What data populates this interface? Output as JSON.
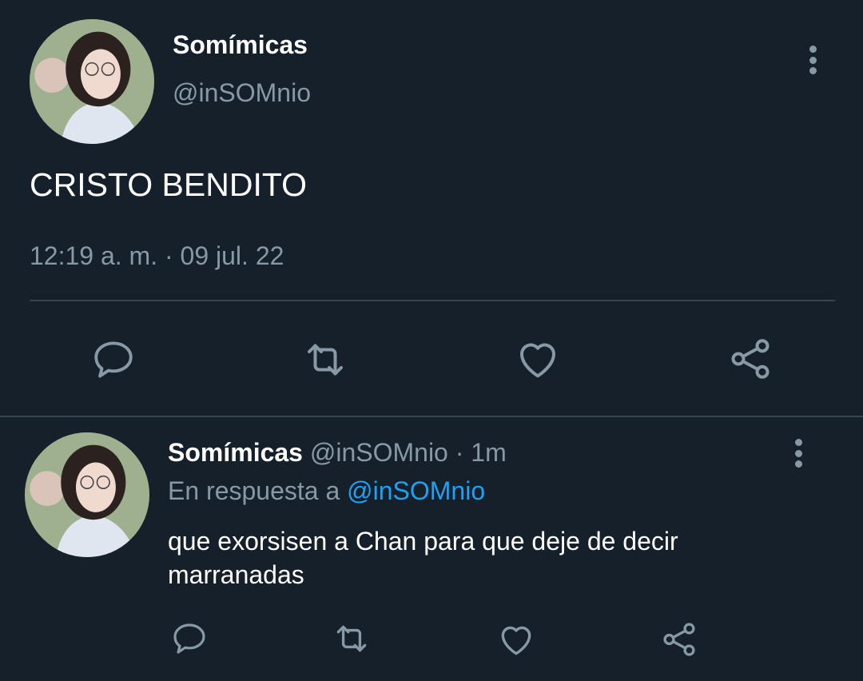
{
  "main_tweet": {
    "display_name": "Somímicas",
    "handle": "@inSOMnio",
    "text": "CRISTO BENDITO",
    "timestamp": "12:19 a. m. · 09 jul. 22"
  },
  "reply_tweet": {
    "display_name": "Somímicas",
    "handle": "@inSOMnio",
    "separator": "·",
    "time_ago": "1m",
    "reply_prefix": "En respuesta a",
    "reply_to": "@inSOMnio",
    "text": "que exorsisen a Chan para que deje de decir marranadas"
  },
  "icons": {
    "reply": "reply-icon",
    "retweet": "retweet-icon",
    "like": "heart-icon",
    "share": "share-icon",
    "more": "more-vertical-icon"
  },
  "colors": {
    "background": "#15202b",
    "muted": "#8899a6",
    "link": "#1da1f2",
    "divider": "#38444d"
  }
}
